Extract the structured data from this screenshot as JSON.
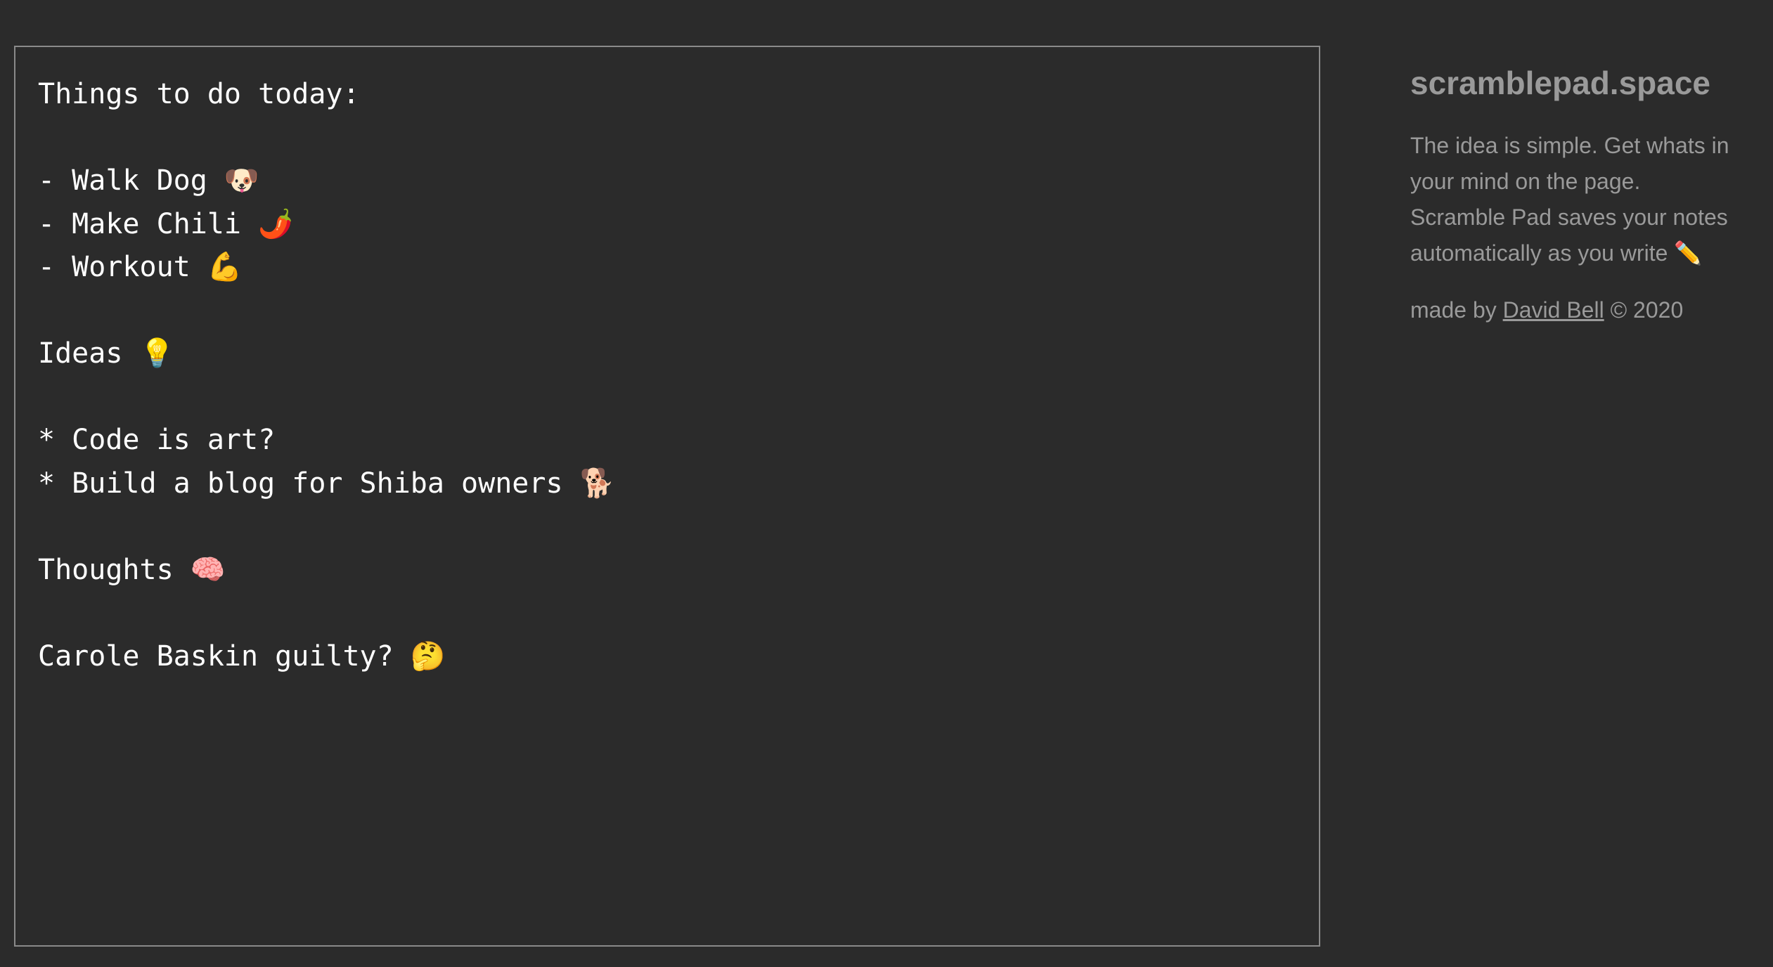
{
  "editor": {
    "content": "Things to do today:\n\n- Walk Dog 🐶\n- Make Chili 🌶️\n- Workout 💪\n\nIdeas 💡\n\n* Code is art?\n* Build a blog for Shiba owners 🐕\n\nThoughts 🧠\n\nCarole Baskin guilty? 🤔"
  },
  "sidebar": {
    "title": "scramblepad.space",
    "description": "The idea is simple. Get whats in your mind on the page. Scramble Pad saves your notes automatically as you write ✏️",
    "credit_prefix": "made by ",
    "author": "David Bell",
    "credit_suffix": " © 2020"
  }
}
